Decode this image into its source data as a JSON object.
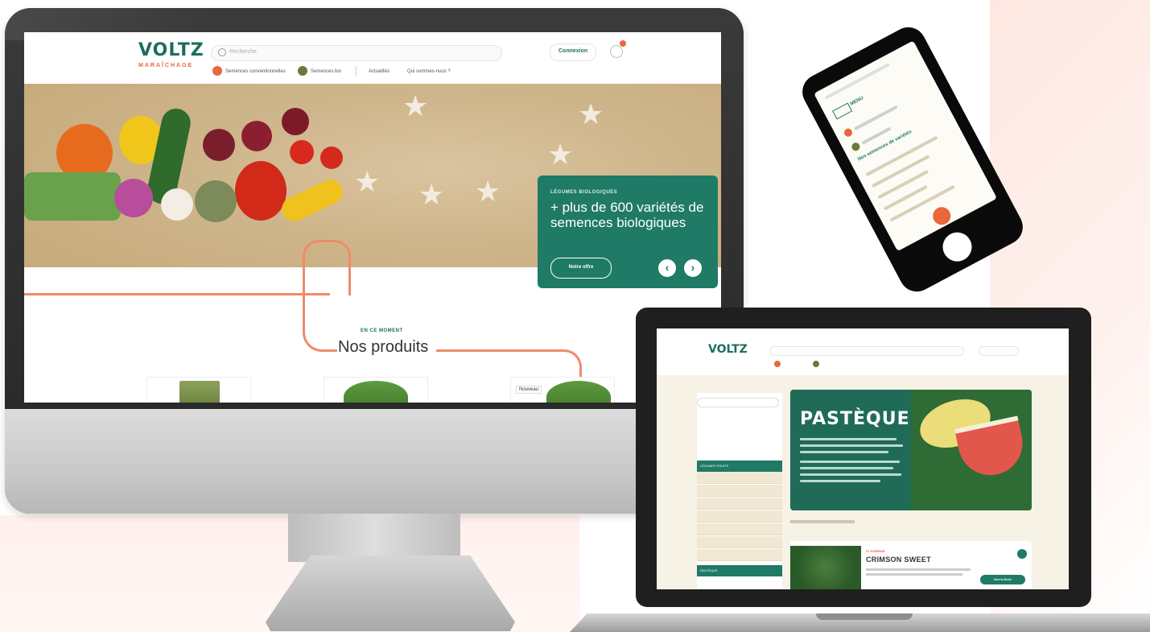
{
  "colors": {
    "brand_green": "#1f7a66",
    "accent_orange": "#e8673d"
  },
  "desktop": {
    "logo": {
      "name": "VOLTZ",
      "tagline": "MARAÎCHAGE"
    },
    "search": {
      "placeholder": "Recherche"
    },
    "connexion_label": "Connexion",
    "nav": {
      "item1": "Semences conventionnelles",
      "item2": "Semences bio",
      "item3": "Actualités",
      "item4": "Qui sommes-nous ?"
    },
    "hero": {
      "kicker": "LÉGUMES BIOLOGIQUES",
      "title": "+ plus de 600 variétés de semences biologiques",
      "button_label": "Notre offre",
      "prev_label": "‹",
      "next_label": "›"
    },
    "section": {
      "kicker": "EN CE MOMENT",
      "title": "Nos produits"
    },
    "product_badge": "Nouveau"
  },
  "phone": {
    "menu_label": "MENU",
    "heading": "Nos semences de variétés"
  },
  "laptop": {
    "logo": "VOLTZ",
    "banner_title": "PASTÈQUE",
    "product": {
      "kicker": "F1 HYBRIDE",
      "name": "CRIMSON SWEET",
      "button_label": "Voir la fiche"
    },
    "sidebar": {
      "active_label": "LÉGUMES FRUITS",
      "active_sub": "PASTÈQUE"
    }
  }
}
